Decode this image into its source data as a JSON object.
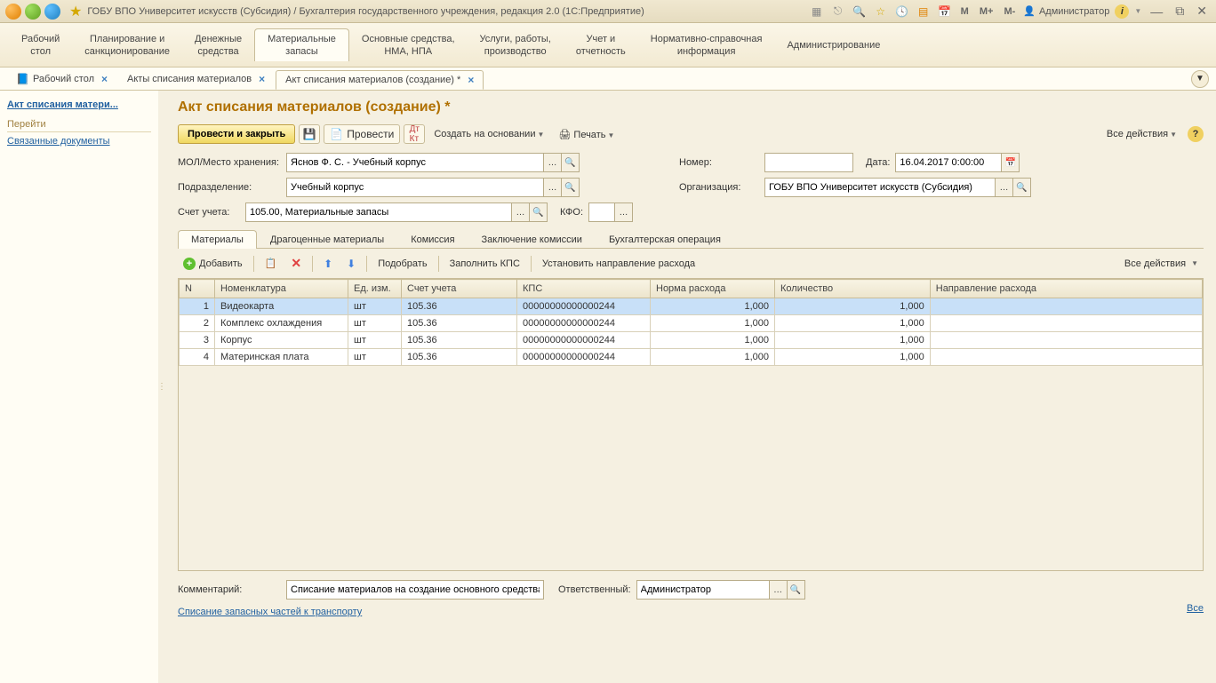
{
  "titlebar": {
    "title": "ГОБУ ВПО Университет искусств (Субсидия) / Бухгалтерия государственного учреждения, редакция 2.0  (1С:Предприятие)",
    "m": "M",
    "mplus": "M+",
    "mminus": "M-",
    "user": "Администратор"
  },
  "mainnav": [
    "Рабочий\nстол",
    "Планирование и\nсанкционирование",
    "Денежные\nсредства",
    "Материальные\nзапасы",
    "Основные средства,\nНМА, НПА",
    "Услуги, работы,\nпроизводство",
    "Учет и\nотчетность",
    "Нормативно-справочная\nинформация",
    "Администрирование"
  ],
  "mainnav_active": 3,
  "tabs": [
    {
      "label": "Рабочий стол",
      "icon": "📘"
    },
    {
      "label": "Акты списания материалов"
    },
    {
      "label": "Акт списания материалов (создание) *"
    }
  ],
  "tabs_active": 2,
  "sidebar": {
    "title": "Акт списания матери...",
    "section": "Перейти",
    "link": "Связанные документы"
  },
  "page": {
    "title": "Акт списания материалов (создание) *",
    "btn_primary": "Провести и закрыть",
    "btn_provesti": "Провести",
    "btn_create_based": "Создать на основании",
    "btn_print": "Печать",
    "all_actions": "Все действия"
  },
  "form": {
    "mol_label": "МОЛ/Место хранения:",
    "mol_value": "Яснов Ф. С. - Учебный корпус",
    "nomer_label": "Номер:",
    "nomer_value": "",
    "data_label": "Дата:",
    "data_value": "16.04.2017 0:00:00",
    "podr_label": "Подразделение:",
    "podr_value": "Учебный корпус",
    "org_label": "Организация:",
    "org_value": "ГОБУ ВПО Университет искусств (Субсидия)",
    "schet_label": "Счет учета:",
    "schet_value": "105.00, Материальные запасы",
    "kfo_label": "КФО:",
    "kfo_value": ""
  },
  "subtabs": [
    "Материалы",
    "Драгоценные материалы",
    "Комиссия",
    "Заключение комиссии",
    "Бухгалтерская операция"
  ],
  "subtabs_active": 0,
  "table_toolbar": {
    "add": "Добавить",
    "select": "Подобрать",
    "fill_kps": "Заполнить КПС",
    "direction": "Установить направление расхода",
    "all_actions": "Все действия"
  },
  "table": {
    "headers": [
      "N",
      "Номенклатура",
      "Ед. изм.",
      "Счет учета",
      "КПС",
      "Норма расхода",
      "Количество",
      "Направление расхода"
    ],
    "rows": [
      {
        "n": "1",
        "nom": "Видеокарта",
        "ed": "шт",
        "schet": "105.36",
        "kps": "00000000000000244",
        "norma": "1,000",
        "kol": "1,000",
        "dir": ""
      },
      {
        "n": "2",
        "nom": "Комплекс охлаждения",
        "ed": "шт",
        "schet": "105.36",
        "kps": "00000000000000244",
        "norma": "1,000",
        "kol": "1,000",
        "dir": ""
      },
      {
        "n": "3",
        "nom": "Корпус",
        "ed": "шт",
        "schet": "105.36",
        "kps": "00000000000000244",
        "norma": "1,000",
        "kol": "1,000",
        "dir": ""
      },
      {
        "n": "4",
        "nom": "Материнская плата",
        "ed": "шт",
        "schet": "105.36",
        "kps": "00000000000000244",
        "norma": "1,000",
        "kol": "1,000",
        "dir": ""
      }
    ]
  },
  "footer": {
    "comment_label": "Комментарий:",
    "comment_value": "Списание материалов на создание основного средства",
    "resp_label": "Ответственный:",
    "resp_value": "Администратор",
    "link": "Списание запасных частей к транспорту",
    "all": "Все"
  }
}
